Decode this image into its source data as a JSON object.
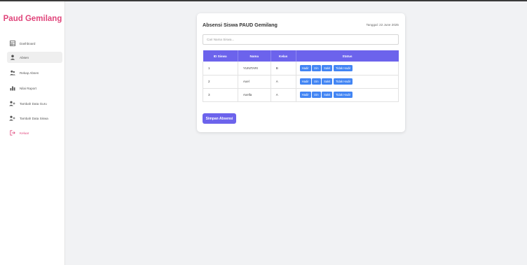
{
  "sidebar": {
    "brand": "Paud Gemilang",
    "items": [
      {
        "label": "Dashboard",
        "icon": "grid-icon"
      },
      {
        "label": "Absen",
        "icon": "user-icon"
      },
      {
        "label": "Rekap Absen",
        "icon": "user-group-icon"
      },
      {
        "label": "Nilai Raport",
        "icon": "chart-icon"
      },
      {
        "label": "Tambah Data Guru",
        "icon": "add-user-icon"
      },
      {
        "label": "Tambah Data Siswa",
        "icon": "add-user-icon"
      },
      {
        "label": "Keluar",
        "icon": "logout-icon"
      }
    ],
    "active_index": 1
  },
  "main": {
    "title": "Absensi Siswa PAUD Gemilang",
    "date": "Tanggal: 22 June 2025",
    "search_placeholder": "Cari Nama Siswa...",
    "table": {
      "headers": [
        "ID Siswa",
        "Nama",
        "Kelas",
        "Status"
      ],
      "rows": [
        {
          "id": "1",
          "nama": "YUNITARI",
          "kelas": "B"
        },
        {
          "id": "2",
          "nama": "Axel",
          "kelas": "A"
        },
        {
          "id": "3",
          "nama": "Axella",
          "kelas": "A"
        }
      ],
      "status_buttons": [
        "Hadir",
        "Izin",
        "Sakit",
        "Tidak Hadir"
      ]
    },
    "save_label": "Simpan Absensi"
  },
  "colors": {
    "brand": "#e0457b",
    "accent": "#6c63ec",
    "status_button": "#4285f4"
  }
}
